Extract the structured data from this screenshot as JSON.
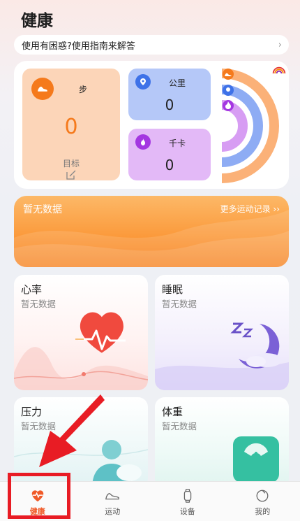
{
  "header": {
    "title": "健康"
  },
  "help_bar": {
    "text": "使用有困惑?使用指南来解答",
    "chevron": "›"
  },
  "summary": {
    "steps": {
      "label": "步",
      "value": "0",
      "goal_label": "目标",
      "icon": "shoe-icon"
    },
    "distance": {
      "label": "公里",
      "value": "0",
      "icon": "location-pin-icon"
    },
    "calories": {
      "label": "千卡",
      "value": "0",
      "icon": "flame-icon"
    },
    "ring_colors": {
      "steps": "#f57a1c",
      "distance": "#3e72e8",
      "calories": "#a437e1"
    }
  },
  "activity": {
    "no_data": "暂无数据",
    "more_link": "更多运动记录 ››"
  },
  "cards": {
    "heart_rate": {
      "title": "心率",
      "subtitle": "暂无数据"
    },
    "sleep": {
      "title": "睡眠",
      "subtitle": "暂无数据"
    },
    "stress": {
      "title": "压力",
      "subtitle": "暂无数据"
    },
    "weight": {
      "title": "体重",
      "subtitle": "暂无数据"
    }
  },
  "tabs": [
    {
      "label": "健康",
      "icon": "heart-pulse-icon",
      "active": true
    },
    {
      "label": "运动",
      "icon": "sneaker-icon",
      "active": false
    },
    {
      "label": "设备",
      "icon": "watch-icon",
      "active": false
    },
    {
      "label": "我的",
      "icon": "profile-icon",
      "active": false
    }
  ],
  "colors": {
    "accent": "#f05a28",
    "annotation": "#e81c24"
  }
}
